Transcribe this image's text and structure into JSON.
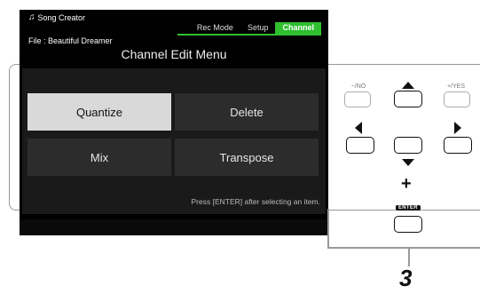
{
  "app": {
    "title": "Song Creator",
    "icon": "music-notes-icon"
  },
  "tabs": [
    {
      "label": "Rec Mode",
      "active": false
    },
    {
      "label": "Setup",
      "active": false
    },
    {
      "label": "Channel",
      "active": true
    }
  ],
  "file": {
    "label": "File : Beautiful Dreamer"
  },
  "menu": {
    "title": "Channel Edit Menu",
    "items": [
      {
        "label": "Quantize",
        "selected": true
      },
      {
        "label": "Delete",
        "selected": false
      },
      {
        "label": "Mix",
        "selected": false
      },
      {
        "label": "Transpose",
        "selected": false
      }
    ],
    "hint": "Press [ENTER] after selecting an item."
  },
  "panel_buttons": {
    "no_label": "−/NO",
    "yes_label": "+/YES",
    "enter_label": "ENTER",
    "plus": "+",
    "step": "3"
  },
  "colors": {
    "accent": "#2fbf2f",
    "selected_bg": "#d9d9d9",
    "screen_bg": "#000000"
  }
}
